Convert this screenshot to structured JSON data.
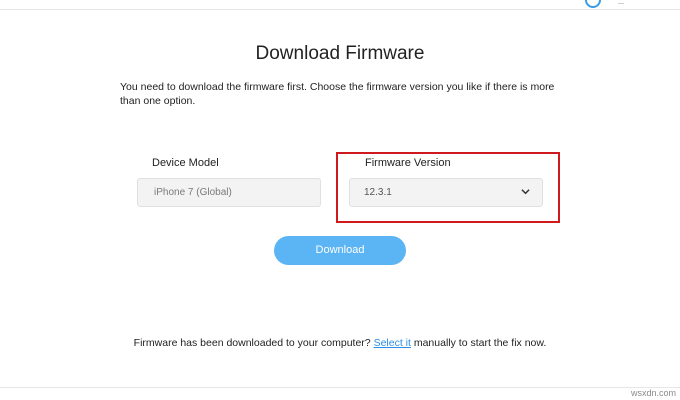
{
  "page": {
    "title": "Download Firmware",
    "description": "You need to download the firmware first. Choose the firmware version you like if there is more than one option."
  },
  "device": {
    "label": "Device Model",
    "value": "iPhone 7 (Global)"
  },
  "firmware": {
    "label": "Firmware Version",
    "selected": "12.3.1",
    "highlight_color": "#d0191c"
  },
  "download_button": {
    "label": "Download",
    "color": "#5bb4f4"
  },
  "footer": {
    "prefix": "Firmware has been downloaded to your computer? ",
    "link": "Select it",
    "suffix": " manually to start the fix now."
  },
  "watermark": "wsxdn.com",
  "icons": {
    "help": "help-icon",
    "dropdown": "chevron-down-icon"
  }
}
